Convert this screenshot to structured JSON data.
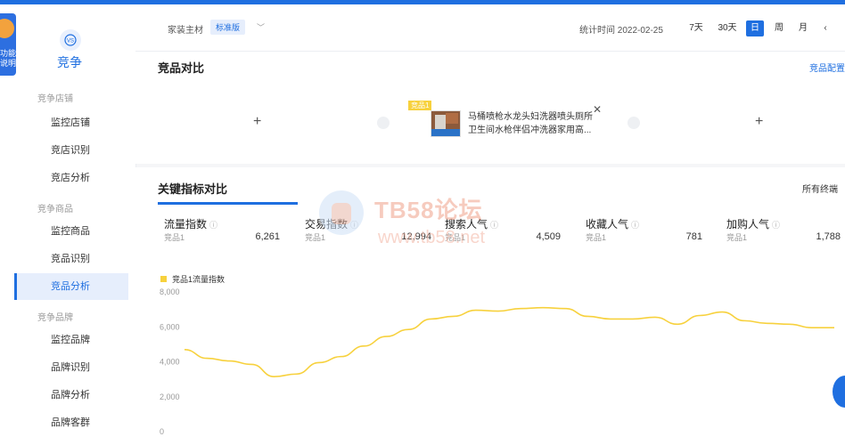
{
  "sidebar": {
    "badge_text": "功能\n说明",
    "title": "竞争",
    "groups": [
      {
        "label": "竞争店铺",
        "items": [
          "监控店铺",
          "竞店识别",
          "竞店分析"
        ]
      },
      {
        "label": "竞争商品",
        "items": [
          "监控商品",
          "竞品识别",
          "竞品分析"
        ]
      },
      {
        "label": "竞争品牌",
        "items": [
          "监控品牌",
          "品牌识别",
          "品牌分析",
          "品牌客群"
        ]
      }
    ],
    "active_item": "竞品分析"
  },
  "header": {
    "category": "家装主材",
    "edition": "标准版",
    "stat_time": "统计时间 2022-02-25",
    "ranges": [
      "7天",
      "30天",
      "日",
      "周",
      "月"
    ],
    "active_range": "日",
    "prev": "‹"
  },
  "compare": {
    "title": "竞品对比",
    "config_link": "竞品配置",
    "product_tag": "竞品1",
    "product_name": "马桶喷枪水龙头妇洗器喷头厕所卫生间水枪伴侣冲洗器家用高..."
  },
  "metrics": {
    "tab": "关键指标对比",
    "terminal": "所有终端",
    "items": [
      {
        "label": "流量指数",
        "sub": "竞品1",
        "value": "6,261"
      },
      {
        "label": "交易指数",
        "sub": "竞品1",
        "value": "12,994"
      },
      {
        "label": "搜索人气",
        "sub": "竞品1",
        "value": "4,509"
      },
      {
        "label": "收藏人气",
        "sub": "竞品1",
        "value": "781"
      },
      {
        "label": "加购人气",
        "sub": "竞品1",
        "value": "1,788"
      }
    ]
  },
  "watermark": {
    "line1": "TB58论坛",
    "line2": "www.tb58.net"
  },
  "chart_data": {
    "type": "line",
    "series": [
      {
        "name": "竞品1流量指数",
        "color": "#f7d13d",
        "values": [
          4700,
          4200,
          4050,
          3850,
          3150,
          3300,
          3950,
          4300,
          4900,
          5450,
          5850,
          6450,
          6600,
          6950,
          6900,
          7050,
          7100,
          7050,
          6600,
          6450,
          6450,
          6550,
          6150,
          6650,
          6850,
          6350,
          6200,
          6150,
          5950,
          5950
        ]
      }
    ],
    "yticks": [
      "8,000",
      "6,000",
      "4,000",
      "2,000",
      "0"
    ],
    "ylim": [
      0,
      8000
    ]
  }
}
